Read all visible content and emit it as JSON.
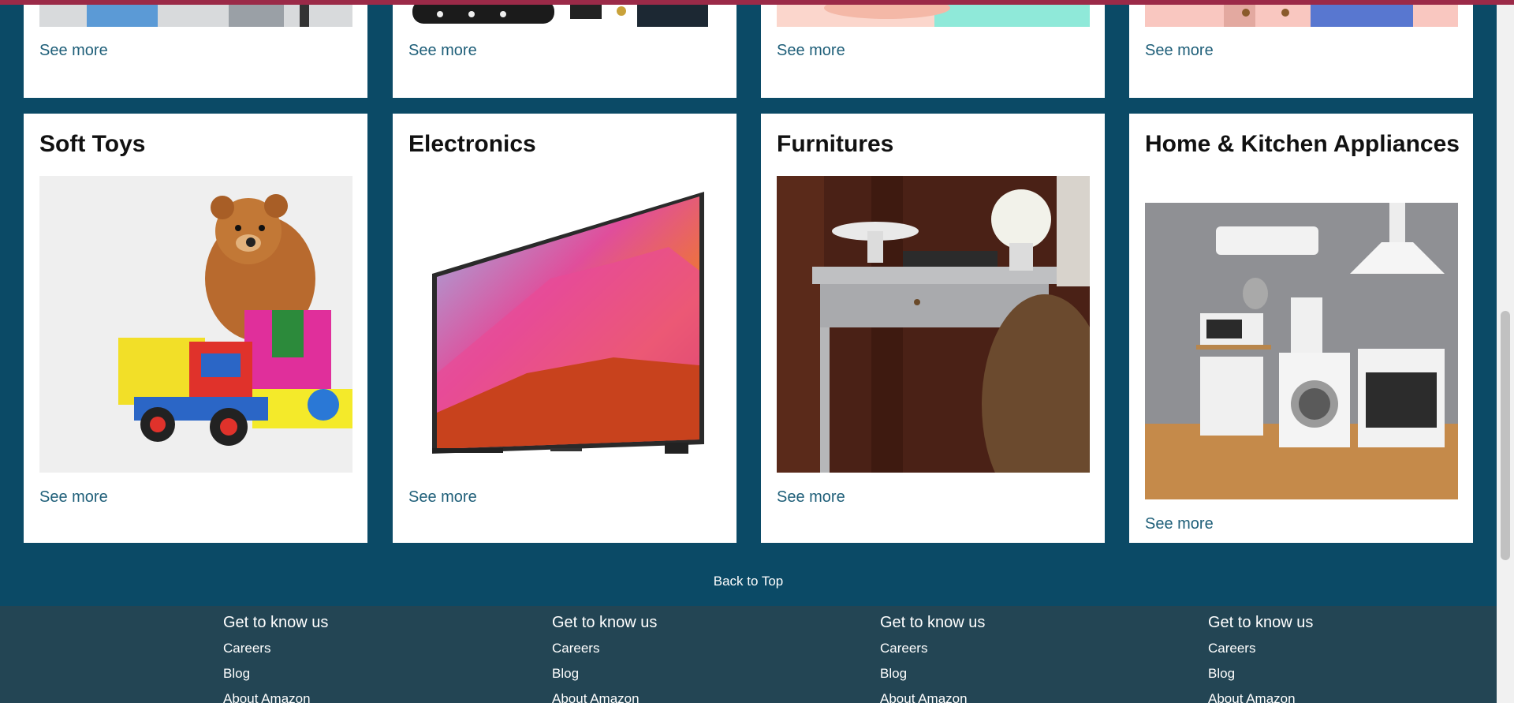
{
  "top_row": [
    {
      "see_more": "See more"
    },
    {
      "see_more": "See more"
    },
    {
      "see_more": "See more"
    },
    {
      "see_more": "See more"
    }
  ],
  "categories": [
    {
      "title": "Soft Toys",
      "image": "teddy-bear-toys-image",
      "see_more": "See more"
    },
    {
      "title": "Electronics",
      "image": "television-image",
      "see_more": "See more"
    },
    {
      "title": "Furnitures",
      "image": "desk-chair-image",
      "see_more": "See more"
    },
    {
      "title": "Home & Kitchen Appliances",
      "image": "kitchen-appliances-image",
      "see_more": "See more"
    }
  ],
  "back_to_top": "Back to Top",
  "footer": {
    "columns": [
      {
        "heading": "Get to know us",
        "links": [
          "Careers",
          "Blog",
          "About Amazon"
        ]
      },
      {
        "heading": "Get to know us",
        "links": [
          "Careers",
          "Blog",
          "About Amazon"
        ]
      },
      {
        "heading": "Get to know us",
        "links": [
          "Careers",
          "Blog",
          "About Amazon"
        ]
      },
      {
        "heading": "Get to know us",
        "links": [
          "Careers",
          "Blog",
          "About Amazon"
        ]
      }
    ]
  },
  "colors": {
    "page_bg": "#0b4a66",
    "footer_bg": "#234554",
    "link": "#1f5f79",
    "top_accent": "#9b2a48"
  }
}
